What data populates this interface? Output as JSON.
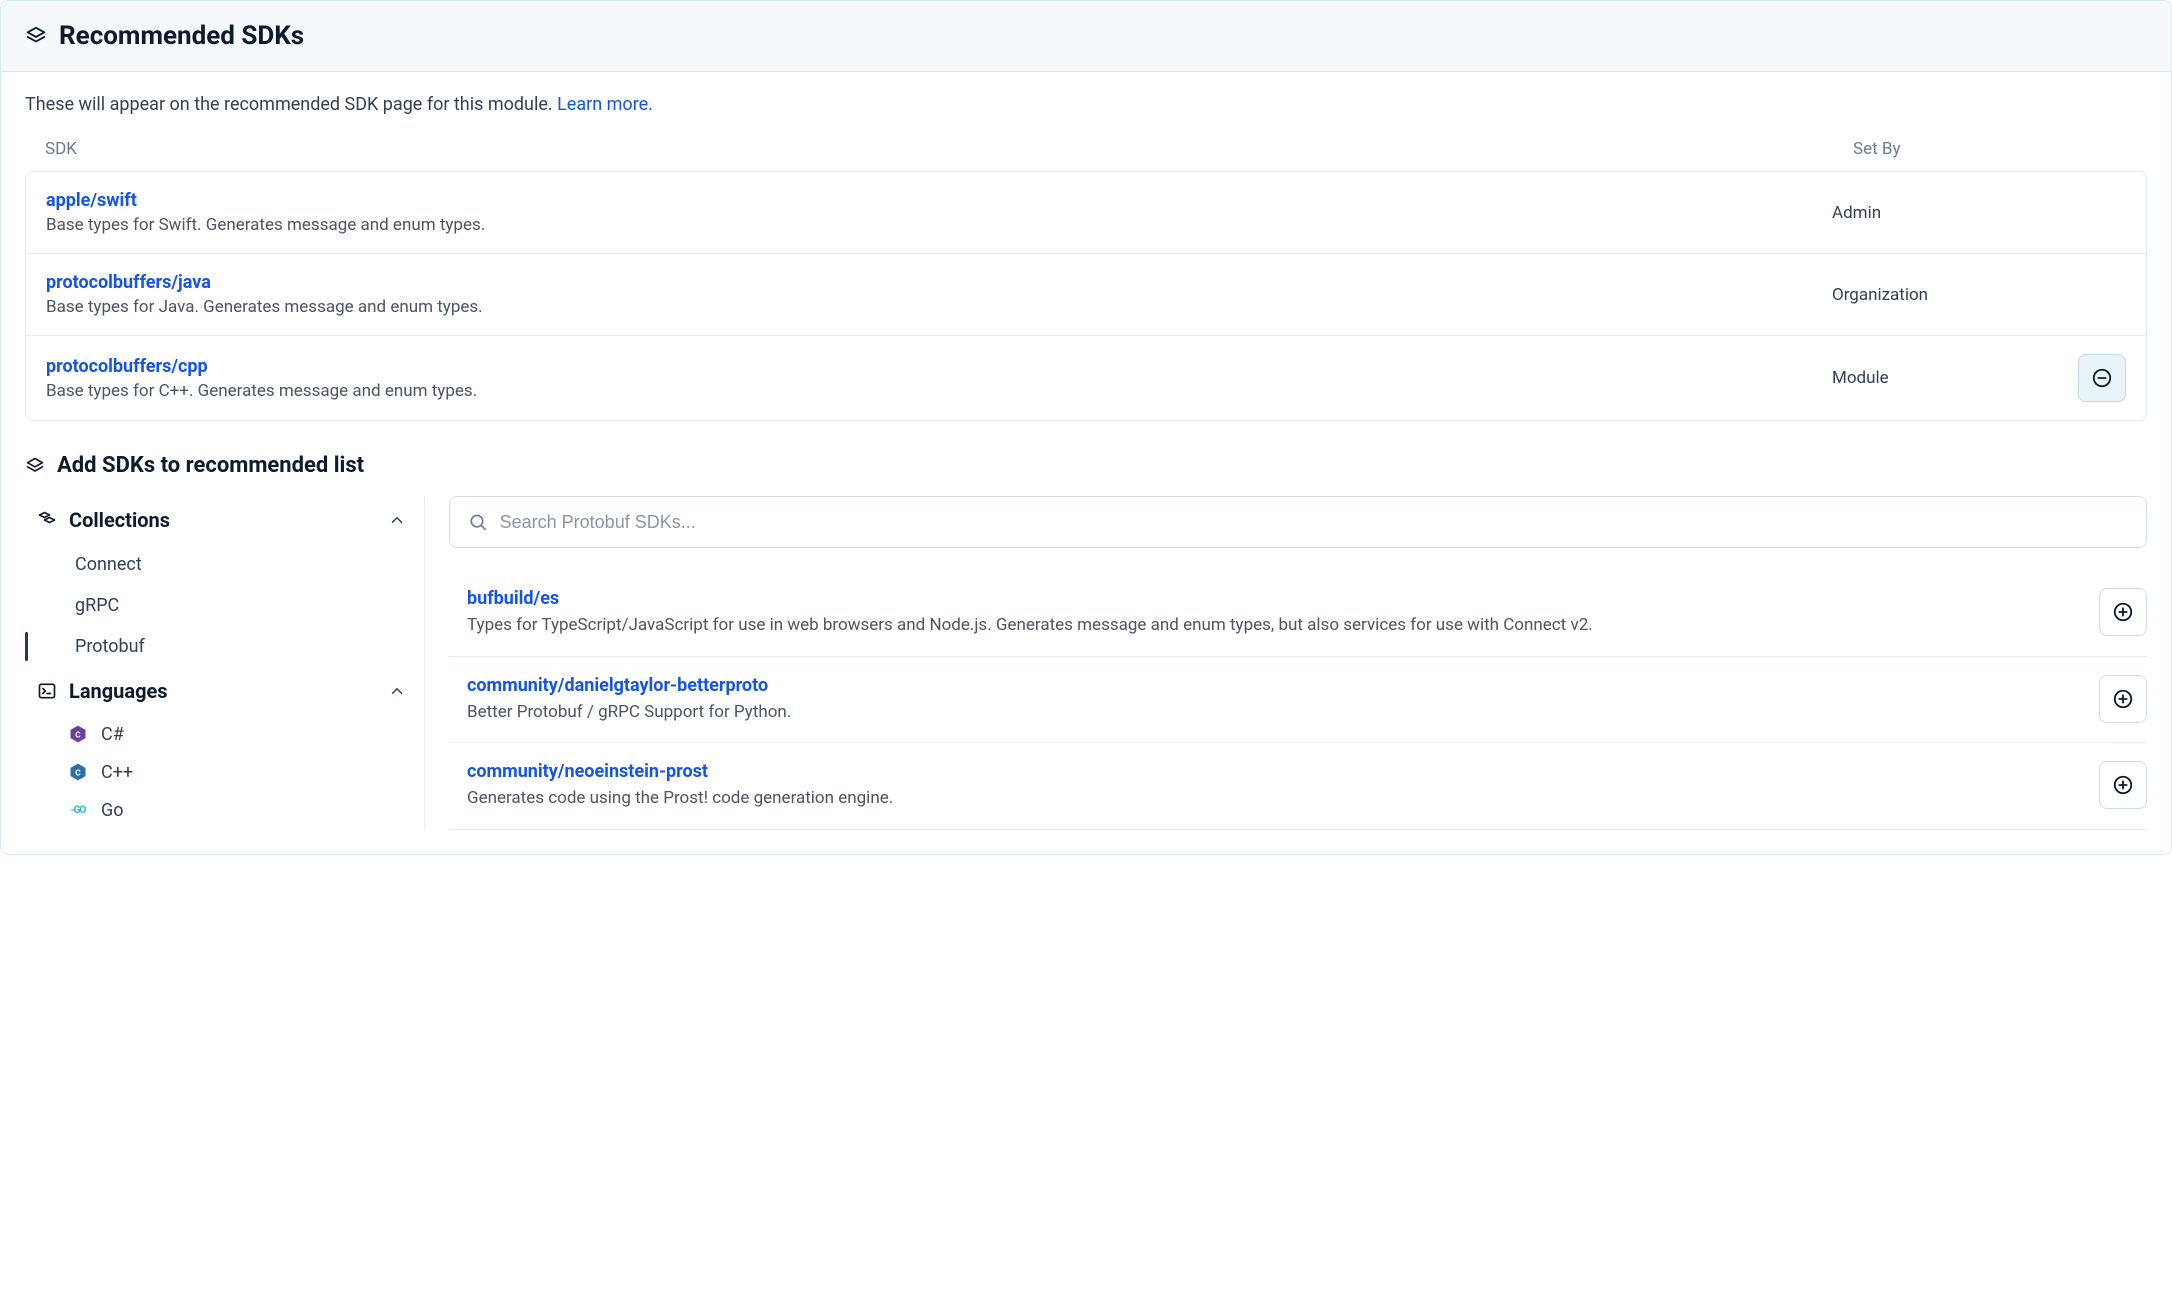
{
  "header": {
    "title": "Recommended SDKs"
  },
  "intro": {
    "text": "These will appear on the recommended SDK page for this module. ",
    "link": "Learn more."
  },
  "columns": {
    "sdk": "SDK",
    "setby": "Set By"
  },
  "recommended": [
    {
      "name": "apple/swift",
      "desc": "Base types for Swift. Generates message and enum types.",
      "setby": "Admin",
      "removable": false
    },
    {
      "name": "protocolbuffers/java",
      "desc": "Base types for Java. Generates message and enum types.",
      "setby": "Organization",
      "removable": false
    },
    {
      "name": "protocolbuffers/cpp",
      "desc": "Base types for C++. Generates message and enum types.",
      "setby": "Module",
      "removable": true
    }
  ],
  "addSection": {
    "title": "Add SDKs to recommended list"
  },
  "sidebar": {
    "collections": {
      "label": "Collections",
      "items": [
        "Connect",
        "gRPC",
        "Protobuf"
      ],
      "activeIndex": 2
    },
    "languages": {
      "label": "Languages",
      "items": [
        {
          "label": "C#",
          "iconColor": "#6b3fa0"
        },
        {
          "label": "C++",
          "iconColor": "#2f6fb0"
        },
        {
          "label": "Go",
          "iconColor": "#29b6d4"
        }
      ]
    }
  },
  "search": {
    "placeholder": "Search Protobuf SDKs..."
  },
  "results": [
    {
      "name": "bufbuild/es",
      "desc": "Types for TypeScript/JavaScript for use in web browsers and Node.js. Generates message and enum types, but also services for use with Connect v2."
    },
    {
      "name": "community/danielgtaylor-betterproto",
      "desc": "Better Protobuf / gRPC Support for Python."
    },
    {
      "name": "community/neoeinstein-prost",
      "desc": "Generates code using the Prost! code generation engine."
    }
  ]
}
